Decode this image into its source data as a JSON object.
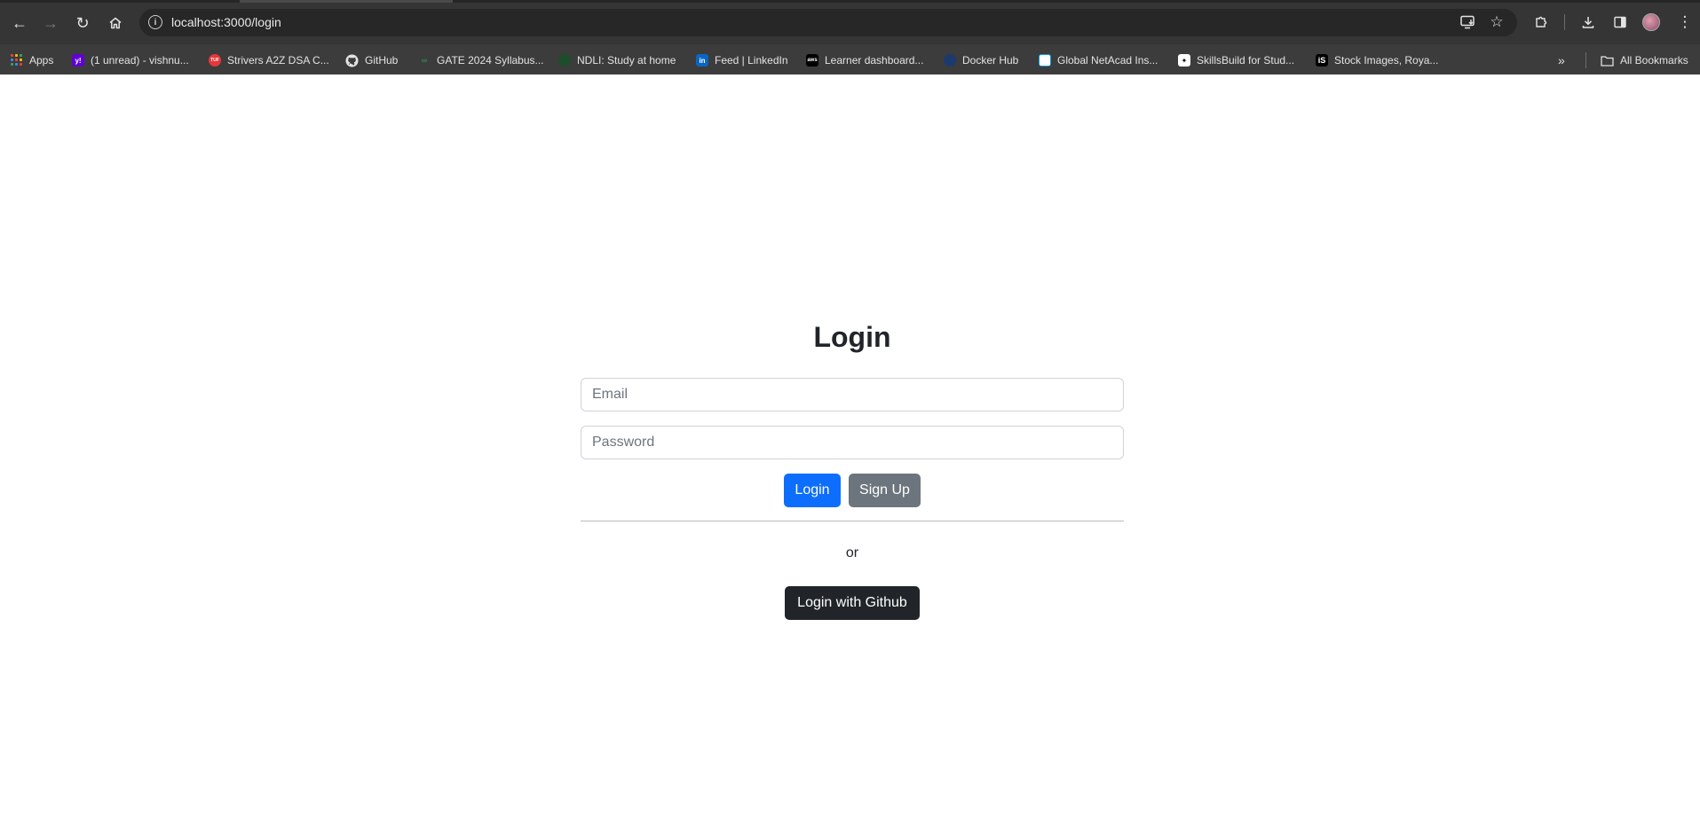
{
  "browser": {
    "url": "localhost:3000/login",
    "nav": {
      "back_icon": "arrow-left-icon",
      "forward_icon": "arrow-right-icon",
      "reload_icon": "reload-icon",
      "home_icon": "home-icon"
    },
    "bookmarks": [
      {
        "label": "Apps",
        "icon": "apps-grid-icon"
      },
      {
        "label": "(1 unread) - vishnu...",
        "icon": "yahoo-mail-icon",
        "color": "#6001d2"
      },
      {
        "label": "Strivers A2Z DSA C...",
        "icon": "tuf-icon",
        "color": "#e5383b"
      },
      {
        "label": "GitHub",
        "icon": "github-icon"
      },
      {
        "label": "GATE 2024 Syllabus...",
        "icon": "gfg-icon",
        "color": "#2f8d46"
      },
      {
        "label": "NDLI: Study at home",
        "icon": "ndli-icon",
        "color": "#1d4d2b"
      },
      {
        "label": "Feed | LinkedIn",
        "icon": "linkedin-icon",
        "color": "#0a66c2"
      },
      {
        "label": "Learner dashboard...",
        "icon": "aws-icon",
        "color": "#000000"
      },
      {
        "label": "Docker Hub",
        "icon": "docker-icon",
        "color": "#1d63ed"
      },
      {
        "label": "Global NetAcad Ins...",
        "icon": "netacad-icon",
        "color": "#049fd9"
      },
      {
        "label": "SkillsBuild for Stud...",
        "icon": "skillsbuild-icon",
        "color": "#ffffff"
      },
      {
        "label": "Stock Images, Roya...",
        "icon": "istock-icon",
        "color": "#000000"
      }
    ],
    "all_bookmarks_label": "All Bookmarks"
  },
  "page": {
    "title": "Login",
    "email_placeholder": "Email",
    "password_placeholder": "Password",
    "login_button": "Login",
    "signup_button": "Sign Up",
    "or_text": "or",
    "github_button": "Login with Github",
    "colors": {
      "primary": "#0d6efd",
      "secondary": "#6c757d",
      "dark": "#212529"
    }
  }
}
